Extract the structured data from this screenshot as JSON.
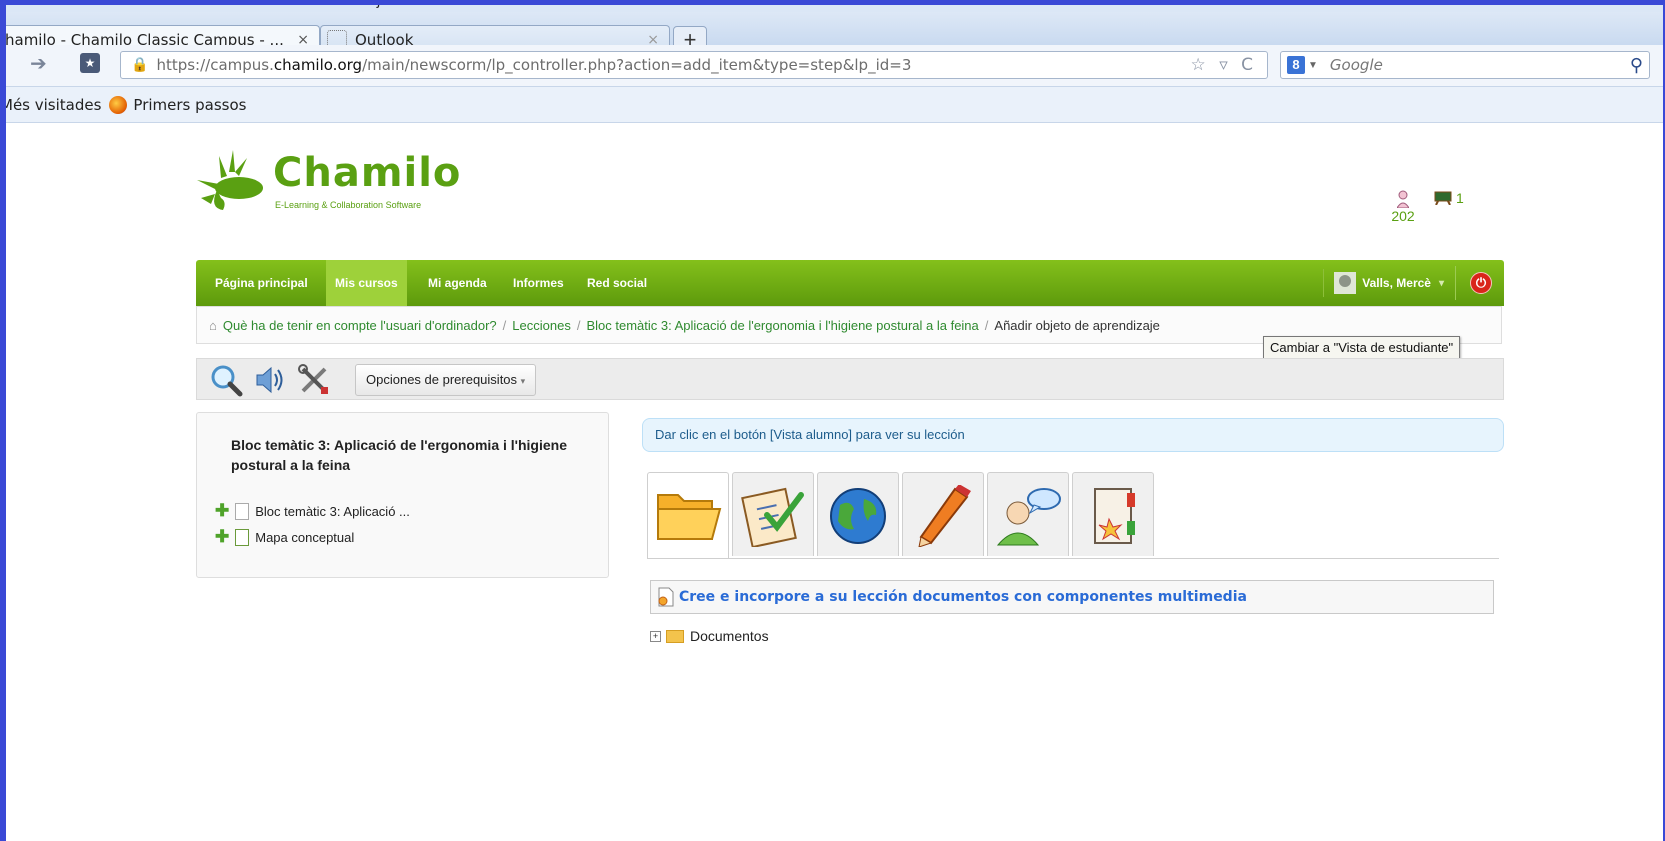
{
  "browser": {
    "menubar": [
      "...Edita  Visualitza  Historial  Adreces d'interès  Eines  Ajuda"
    ],
    "tabs": [
      {
        "label": "hamilo - Chamilo Classic Campus - ...",
        "close": "×"
      },
      {
        "label": "Outlook",
        "close": "×"
      }
    ],
    "new_tab": "+",
    "url": {
      "scheme": "https://campus.",
      "host": "chamilo.org",
      "path": "/main/newscorm/lp_controller.php?action=add_item&type=step&lp_id=3"
    },
    "url_tools": "☆ ▿ C",
    "search_engine_badge": "8",
    "search_placeholder": "Google",
    "bookmarks": [
      "Més visitades",
      "Primers passos"
    ]
  },
  "site": {
    "logo_word": "Chamilo",
    "logo_sub": "E-Learning & Collaboration Software",
    "users_online": "202",
    "courses_count": "1"
  },
  "menu": {
    "items": [
      "Página principal",
      "Mis cursos",
      "Mi agenda",
      "Informes",
      "Red social"
    ],
    "active_index": 1,
    "user": "Valls, Mercè",
    "user_caret": "▾"
  },
  "breadcrumb": {
    "items": [
      "Què ha de tenir en compte l'usuari d'ordinador?",
      "Lecciones",
      "Bloc temàtic 3: Aplicació de l'ergonomia i l'higiene postural a la feina"
    ],
    "current": "Añadir objeto de aprendizaje",
    "separator": "/"
  },
  "tooltip": "Cambiar a \"Vista de estudiante\"",
  "toolbar": {
    "icons": [
      "search-icon",
      "audio-icon",
      "tools-icon"
    ],
    "prereq_label": "Opciones de prerequisitos"
  },
  "lesson": {
    "title": "Bloc temàtic 3: Aplicació de l'ergonomia i l'higiene postural a la feina",
    "items": [
      "Bloc temàtic 3: Aplicació ...",
      "Mapa conceptual"
    ]
  },
  "info_message": "Dar clic en el botón [Vista alumno] para ver su lección",
  "resource_tabs": [
    "folder-icon",
    "checklist-icon",
    "globe-icon",
    "pencil-icon",
    "user-chat-icon",
    "binder-icon"
  ],
  "section_title": "Cree e incorpore a su lección documentos con componentes multimedia",
  "tree": {
    "expander": "+",
    "label": "Documentos"
  },
  "colors": {
    "brand_green": "#6aab17",
    "link_green": "#2f8a2f",
    "section_blue": "#2a6bd6",
    "frame_blue": "#3a49d6"
  }
}
